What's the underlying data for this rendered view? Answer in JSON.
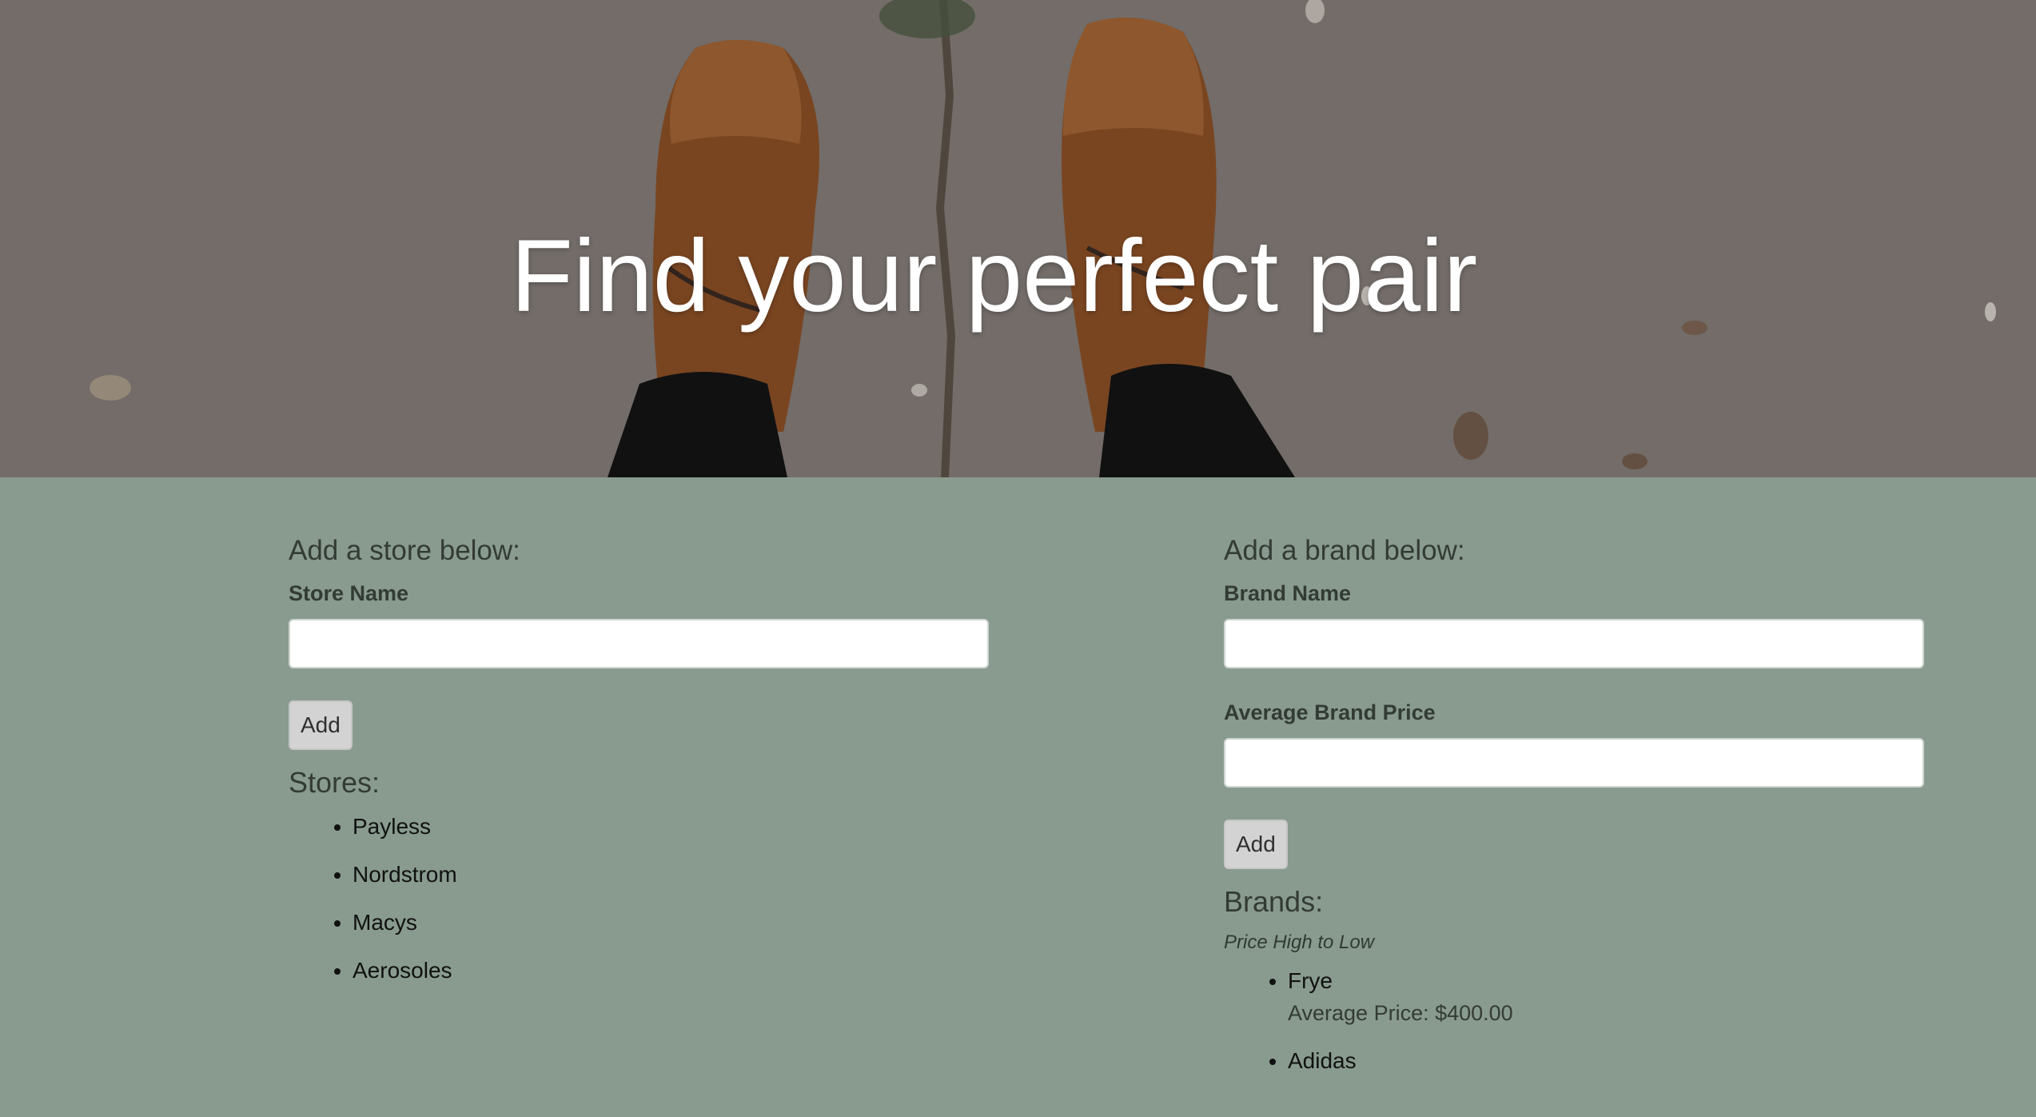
{
  "hero": {
    "title": "Find your perfect pair"
  },
  "stores_section": {
    "heading": "Add a store below:",
    "store_name_label": "Store Name",
    "store_name_value": "",
    "add_label": "Add",
    "list_heading": "Stores:",
    "stores": [
      "Payless",
      "Nordstrom",
      "Macys",
      "Aerosoles"
    ]
  },
  "brands_section": {
    "heading": "Add a brand below:",
    "brand_name_label": "Brand Name",
    "brand_name_value": "",
    "price_label": "Average Brand Price",
    "price_value": "",
    "add_label": "Add",
    "list_heading": "Brands:",
    "sort_note": "Price High to Low",
    "brands": [
      {
        "name": "Frye",
        "price_text": "Average Price: $400.00"
      },
      {
        "name": "Adidas",
        "price_text": ""
      }
    ]
  },
  "colors": {
    "content_bg": "#899b8e",
    "input_bg": "#ffffff",
    "button_bg": "#d3d3d3"
  }
}
